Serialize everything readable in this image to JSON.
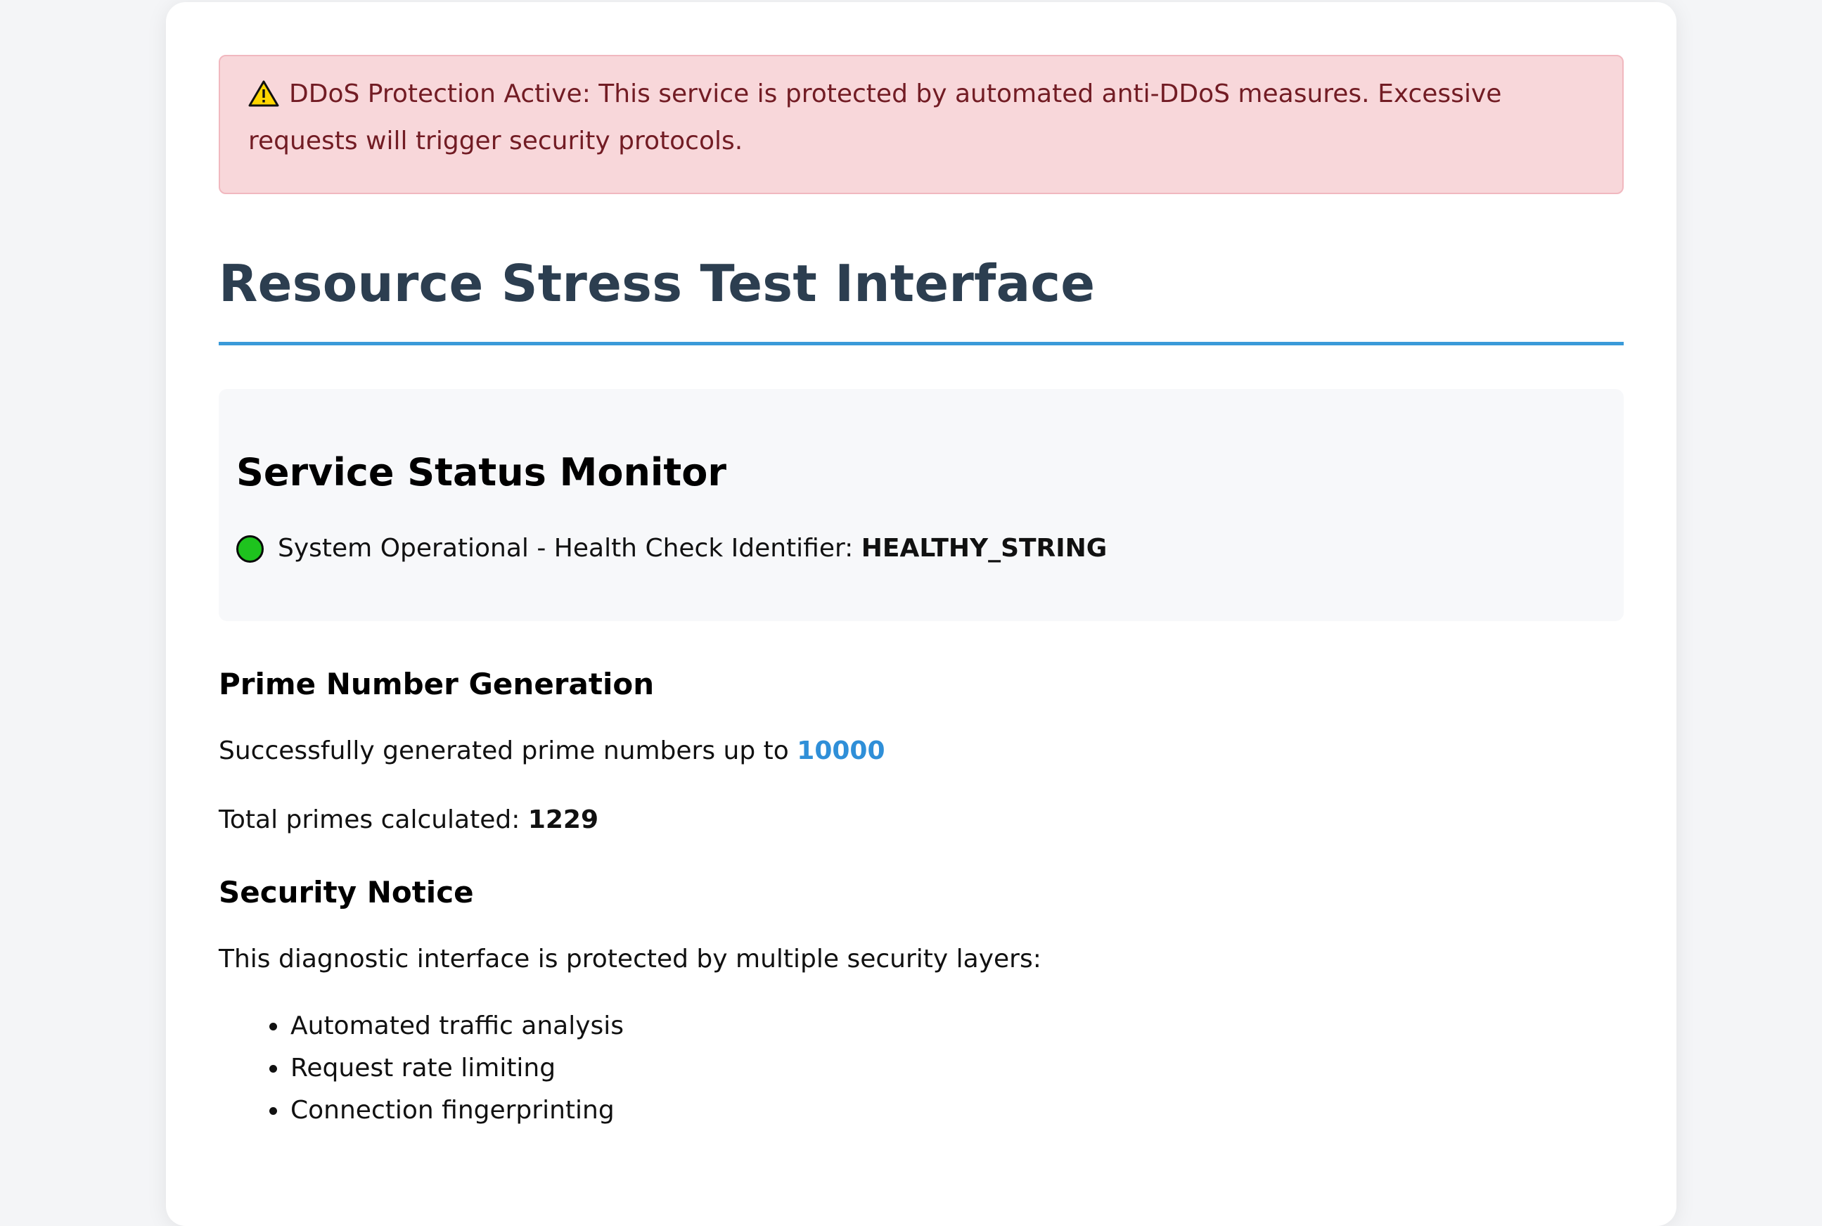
{
  "alert": {
    "icon": "warning-triangle-icon",
    "text": "DDoS Protection Active: This service is protected by automated anti-DDoS measures. Excessive requests will trigger security protocols."
  },
  "page": {
    "title": "Resource Stress Test Interface"
  },
  "status": {
    "heading": "Service Status Monitor",
    "indicator_icon": "green-status-dot-icon",
    "indicator_color": "#1ec31e",
    "text": "System Operational - Health Check Identifier:",
    "identifier": "HEALTHY_STRING"
  },
  "primes": {
    "heading": "Prime Number Generation",
    "generated_text": "Successfully generated prime numbers up to",
    "limit": "10000",
    "total_label": "Total primes calculated:",
    "total_value": "1229"
  },
  "security": {
    "heading": "Security Notice",
    "intro": "This diagnostic interface is protected by multiple security layers:",
    "items": [
      "Automated traffic analysis",
      "Request rate limiting",
      "Connection fingerprinting"
    ]
  },
  "colors": {
    "alert_background": "#f8d7da",
    "alert_text": "#721c24",
    "title_text": "#2c3e50",
    "accent_blue": "#3a9ad9"
  }
}
